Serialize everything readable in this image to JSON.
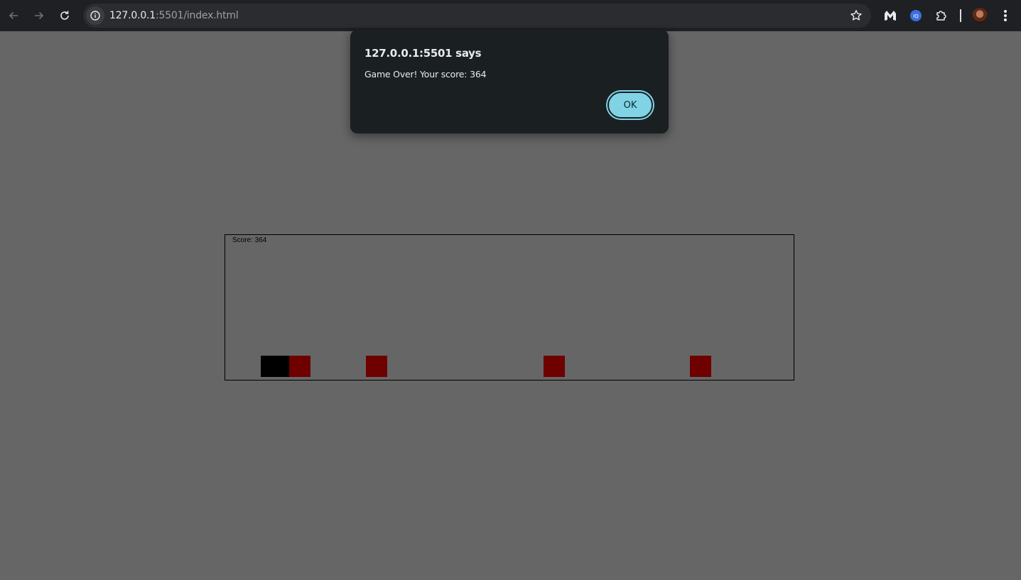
{
  "browser": {
    "url_host": "127.0.0.1",
    "url_path": ":5501/index.html",
    "icons": {
      "back": "arrow-left-icon",
      "forward": "arrow-right-icon",
      "reload": "reload-icon",
      "info": "info-icon",
      "bookmark": "star-icon",
      "extension1": "malwarebytes-icon",
      "extension2": "extension-blue-icon",
      "extensions": "puzzle-icon",
      "menu": "more-vert-icon"
    }
  },
  "dialog": {
    "title": "127.0.0.1:5501 says",
    "message": "Game Over! Your score: 364",
    "ok_label": "OK"
  },
  "game": {
    "score_text": "Score: 364",
    "score": 364,
    "colors": {
      "background": "#666666",
      "player": "#000000",
      "obstacle": "#6e0000"
    }
  }
}
